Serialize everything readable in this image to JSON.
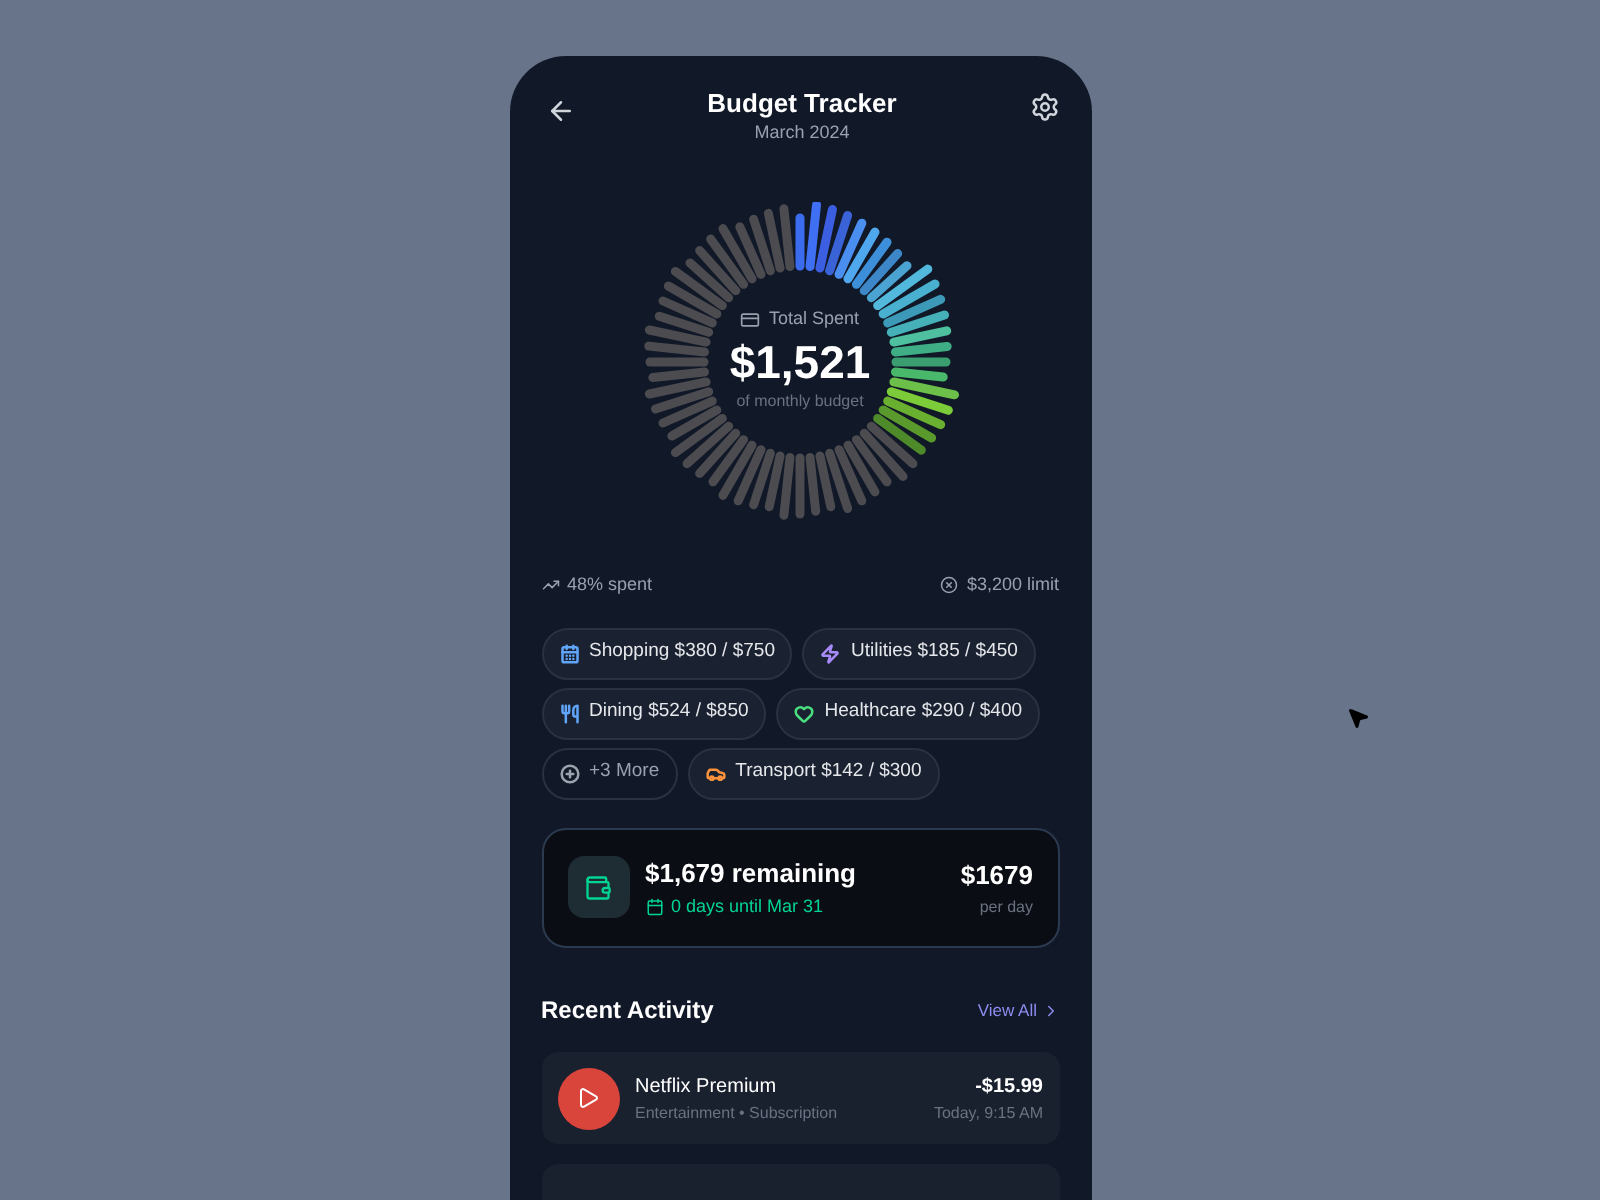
{
  "header": {
    "title": "Budget Tracker",
    "subtitle": "March 2024"
  },
  "summary": {
    "label": "Total Spent",
    "amount": "$1,521",
    "caption": "of monthly budget"
  },
  "stats": {
    "spent": "48% spent",
    "limit": "$3,200 limit"
  },
  "categories": [
    {
      "kind": "category",
      "label": "Shopping $380 / $750",
      "color": "#60a5fa"
    },
    {
      "kind": "category",
      "label": "Utilities $185 / $450",
      "color": "#a78bfa"
    },
    {
      "kind": "category",
      "label": "Dining $524 / $850",
      "color": "#60a5fa"
    },
    {
      "kind": "category",
      "label": "Healthcare $290 / $400",
      "color": "#4ade80"
    },
    {
      "kind": "more",
      "label": "+3 More",
      "color": "#9ca3af"
    },
    {
      "kind": "category",
      "label": "Transport $142 / $300",
      "color": "#fb923c"
    }
  ],
  "remaining": {
    "title": "$1,679 remaining",
    "days": "0 days until Mar 31",
    "per_day_amount": "$1679",
    "per_day_label": "per day"
  },
  "activity": {
    "title": "Recent Activity",
    "link": "View All",
    "items": [
      {
        "name": "Netflix Premium",
        "detail": "Entertainment • Subscription",
        "amount": "-$15.99",
        "time": "Today, 9:15 AM"
      }
    ]
  }
}
